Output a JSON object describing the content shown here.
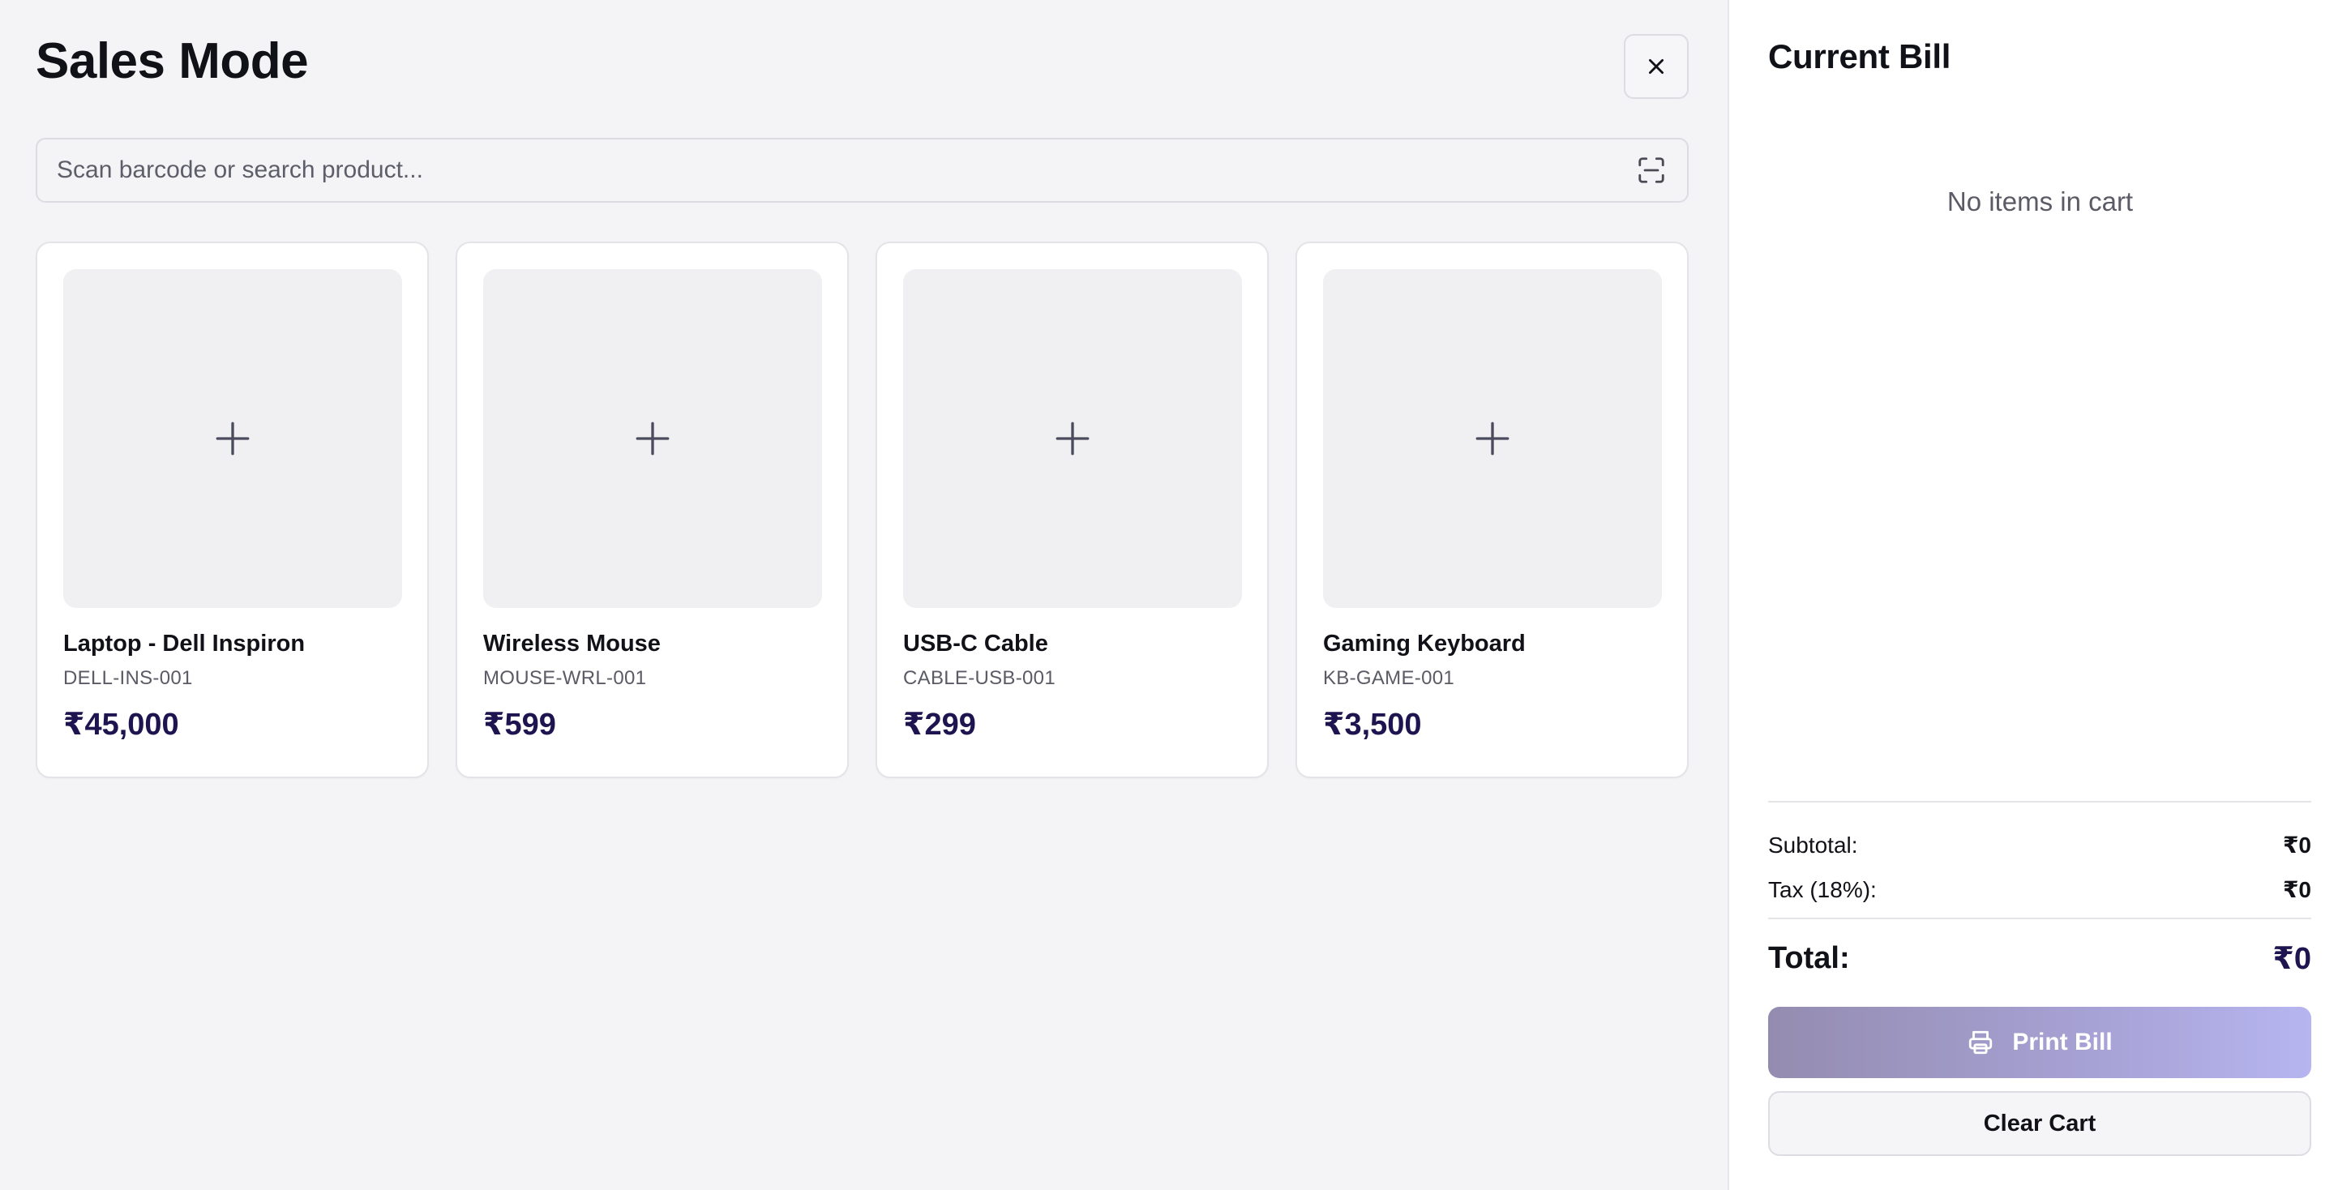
{
  "header": {
    "title": "Sales Mode",
    "close_icon": "close-icon"
  },
  "search": {
    "placeholder": "Scan barcode or search product...",
    "value": "",
    "scan_icon": "barcode-scan-icon"
  },
  "products": [
    {
      "name": "Laptop - Dell Inspiron",
      "sku": "DELL-INS-001",
      "price": "₹45,000",
      "thumb_icon": "plus-icon"
    },
    {
      "name": "Wireless Mouse",
      "sku": "MOUSE-WRL-001",
      "price": "₹599",
      "thumb_icon": "plus-icon"
    },
    {
      "name": "USB-C Cable",
      "sku": "CABLE-USB-001",
      "price": "₹299",
      "thumb_icon": "plus-icon"
    },
    {
      "name": "Gaming Keyboard",
      "sku": "KB-GAME-001",
      "price": "₹3,500",
      "thumb_icon": "plus-icon"
    }
  ],
  "bill": {
    "title": "Current Bill",
    "empty_message": "No items in cart",
    "subtotal_label": "Subtotal:",
    "subtotal_value": "₹0",
    "tax_label": "Tax (18%):",
    "tax_value": "₹0",
    "total_label": "Total:",
    "total_value": "₹0",
    "print_label": "Print Bill",
    "print_icon": "printer-icon",
    "clear_label": "Clear Cart"
  },
  "colors": {
    "background": "#f4f4f6",
    "price_text": "#1e1550",
    "print_button_start": "#948cb0",
    "print_button_end": "#b7b5f0"
  }
}
